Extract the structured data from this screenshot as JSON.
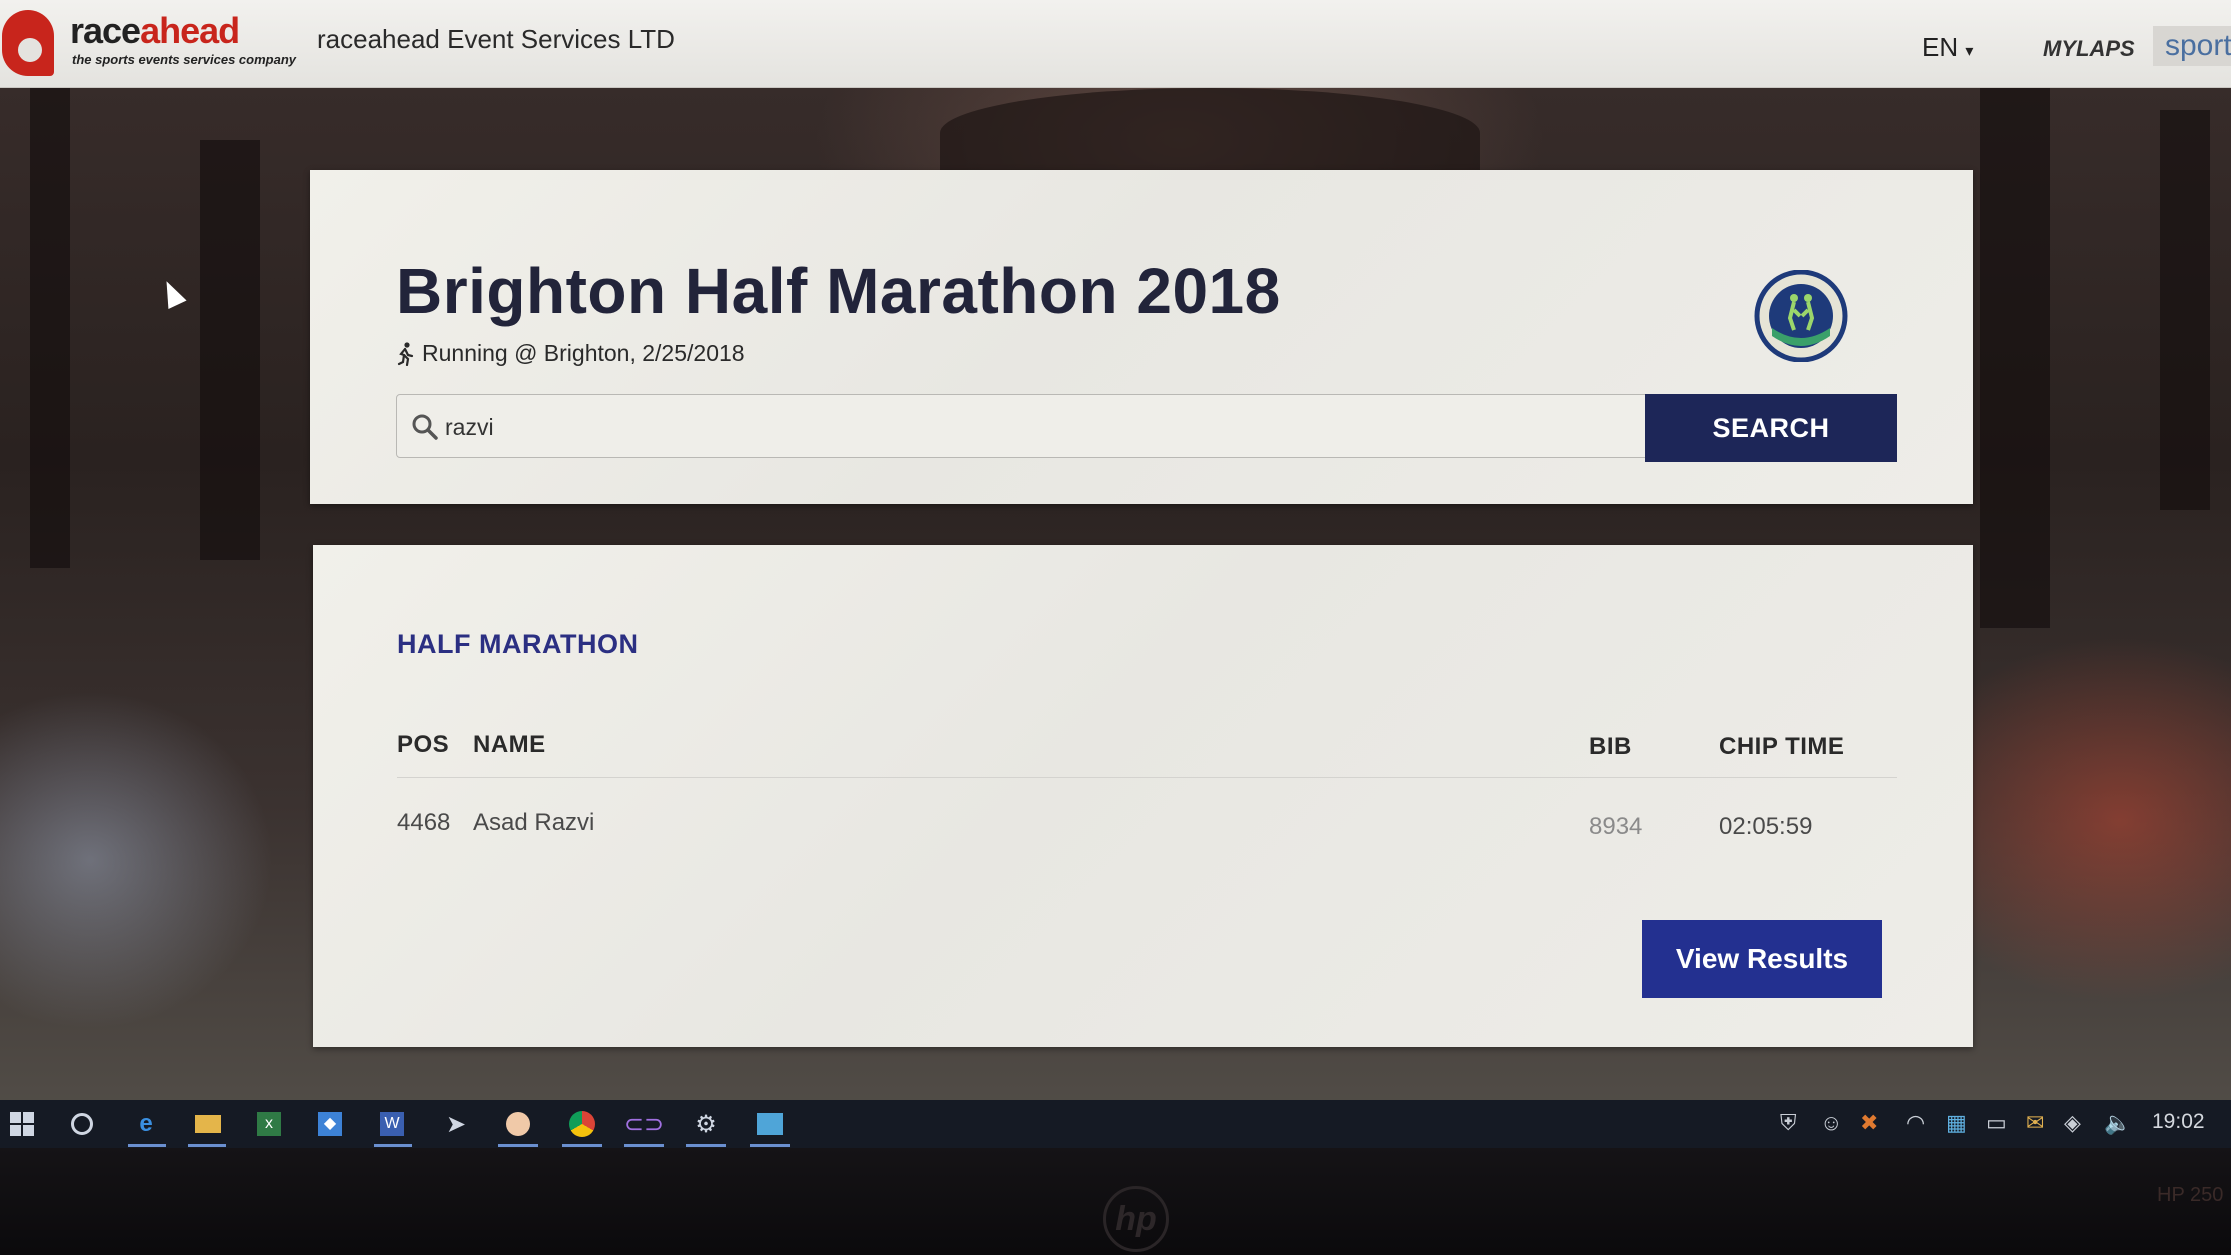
{
  "header": {
    "logo_text_dark": "race",
    "logo_text_accent": "ahead",
    "logo_tagline": "the sports events services company",
    "site_title": "raceahead Event Services LTD",
    "language": "EN",
    "mylaps": "MYLAPS",
    "sport": "sport"
  },
  "event": {
    "title": "Brighton Half Marathon 2018",
    "subtitle": "Running @ Brighton, 2/25/2018",
    "logo_icon": "brighton-half-marathon-logo"
  },
  "search": {
    "value": "razvi",
    "button_label": "SEARCH"
  },
  "results": {
    "section_heading": "HALF MARATHON",
    "columns": {
      "pos": "POS",
      "name": "NAME",
      "bib": "BIB",
      "chip_time": "CHIP TIME"
    },
    "rows": [
      {
        "pos": "4468",
        "name": "Asad Razvi",
        "bib": "8934",
        "chip_time": "02:05:59"
      }
    ],
    "view_results_label": "View Results"
  },
  "taskbar": {
    "clock": "19:02",
    "icons": [
      "windows-start-icon",
      "cortana-icon",
      "edge-icon",
      "file-explorer-icon",
      "excel-icon",
      "dropbox-icon",
      "word-icon",
      "app-icon",
      "outlook-icon",
      "chrome-icon",
      "app-icon",
      "settings-icon",
      "app-icon"
    ]
  },
  "bezel": {
    "brand": "hp",
    "model": "HP 250"
  },
  "colors": {
    "primary_button": "#1d2658",
    "view_results_button": "#233090",
    "heading": "#2b2f82",
    "brand_red": "#c8251c"
  }
}
